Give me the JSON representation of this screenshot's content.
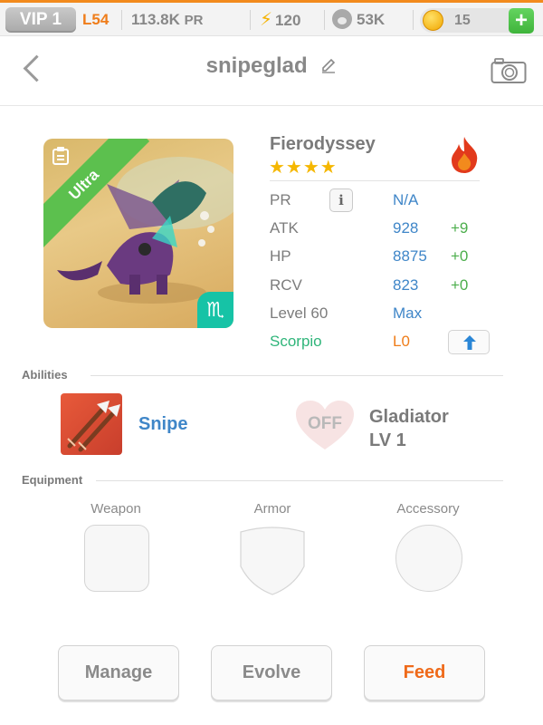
{
  "status_bar": {
    "vip": "VIP 1",
    "level": "L54",
    "pr_value": "113.8K",
    "pr_unit": "PR",
    "energy": "120",
    "paw": "53K",
    "coins": "15",
    "add_label": "+"
  },
  "header": {
    "title": "snipeglad",
    "icons": [
      "back-chevron-icon",
      "pencil-icon",
      "camera-icon"
    ]
  },
  "creature": {
    "rarity": "Ultra",
    "name": "Fierodyssey",
    "stars": "★★★★",
    "star_count": 4,
    "element_icon": "fire-icon",
    "zodiac_symbol": "♏",
    "stats": {
      "pr_label": "PR",
      "pr_info": "i",
      "pr_value": "N/A",
      "atk_label": "ATK",
      "atk_value": "928",
      "atk_delta": "+9",
      "hp_label": "HP",
      "hp_value": "8875",
      "hp_delta": "+0",
      "rcv_label": "RCV",
      "rcv_value": "823",
      "rcv_delta": "+0",
      "level_label": "Level 60",
      "level_value": "Max",
      "sign_label": "Scorpio",
      "sign_value": "L0"
    }
  },
  "abilities": {
    "heading": "Abilities",
    "primary_name": "Snipe",
    "secondary_status": "OFF",
    "secondary_name": "Gladiator",
    "secondary_level": "LV 1"
  },
  "equipment": {
    "heading": "Equipment",
    "weapon": "Weapon",
    "armor": "Armor",
    "accessory": "Accessory"
  },
  "actions": {
    "manage": "Manage",
    "evolve": "Evolve",
    "feed": "Feed"
  },
  "colors": {
    "accent_orange": "#ef7d1a",
    "stat_blue": "#3f86c8",
    "delta_green": "#4cae4c",
    "ultra_green": "#5cc04e",
    "zodiac_teal": "#16c3a6"
  }
}
